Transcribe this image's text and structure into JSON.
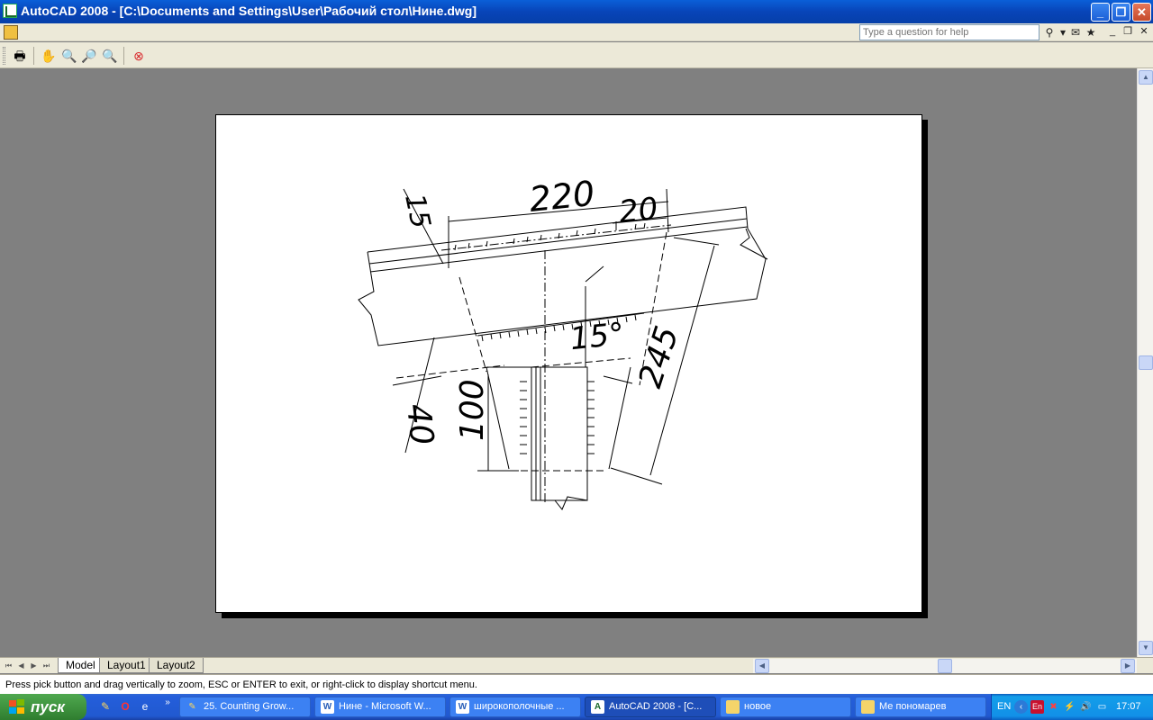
{
  "window": {
    "title": "AutoCAD 2008 - [C:\\Documents and Settings\\User\\Рабочий стол\\Нине.dwg]",
    "minimize": "_",
    "restore": "❐",
    "close": "✕"
  },
  "menubar": {
    "help_placeholder": "Type a question for help",
    "mdi_min": "_",
    "mdi_restore": "❐",
    "mdi_close": "✕"
  },
  "toolbar": {
    "items": [
      {
        "name": "plot-icon",
        "glyph": "🖶"
      },
      {
        "name": "pan-icon",
        "glyph": "✋"
      },
      {
        "name": "zoom-realtime-icon",
        "glyph": "🔍"
      },
      {
        "name": "zoom-window-icon",
        "glyph": "🔎"
      },
      {
        "name": "zoom-previous-icon",
        "glyph": "🔍"
      },
      {
        "name": "close-preview-icon",
        "glyph": "✖"
      }
    ]
  },
  "drawing": {
    "dims": {
      "d220": "220",
      "d20": "20",
      "d15": "15",
      "d15deg": "15°",
      "d245": "245",
      "d100": "100",
      "d40": "40"
    }
  },
  "tabs": {
    "model": "Model",
    "layout1": "Layout1",
    "layout2": "Layout2"
  },
  "command_line": "Press pick button and drag vertically to zoom, ESC or ENTER to exit, or right-click to display shortcut menu.",
  "taskbar": {
    "start": "пуск",
    "tasks": [
      {
        "label": "25. Counting Grow..."
      },
      {
        "label": "Нине - Microsoft W..."
      },
      {
        "label": "широкополочные ..."
      },
      {
        "label": "AutoCAD 2008 - [C..."
      },
      {
        "label": "новое"
      },
      {
        "label": "Ме пономарев"
      }
    ],
    "tray": {
      "lang": "EN",
      "clock": "17:07"
    }
  },
  "colors": {
    "titlebar": "#0a5fd8",
    "canvas_bg": "#808080",
    "paper": "#ffffff",
    "taskbar": "#245edb",
    "start": "#3c8f3c"
  }
}
